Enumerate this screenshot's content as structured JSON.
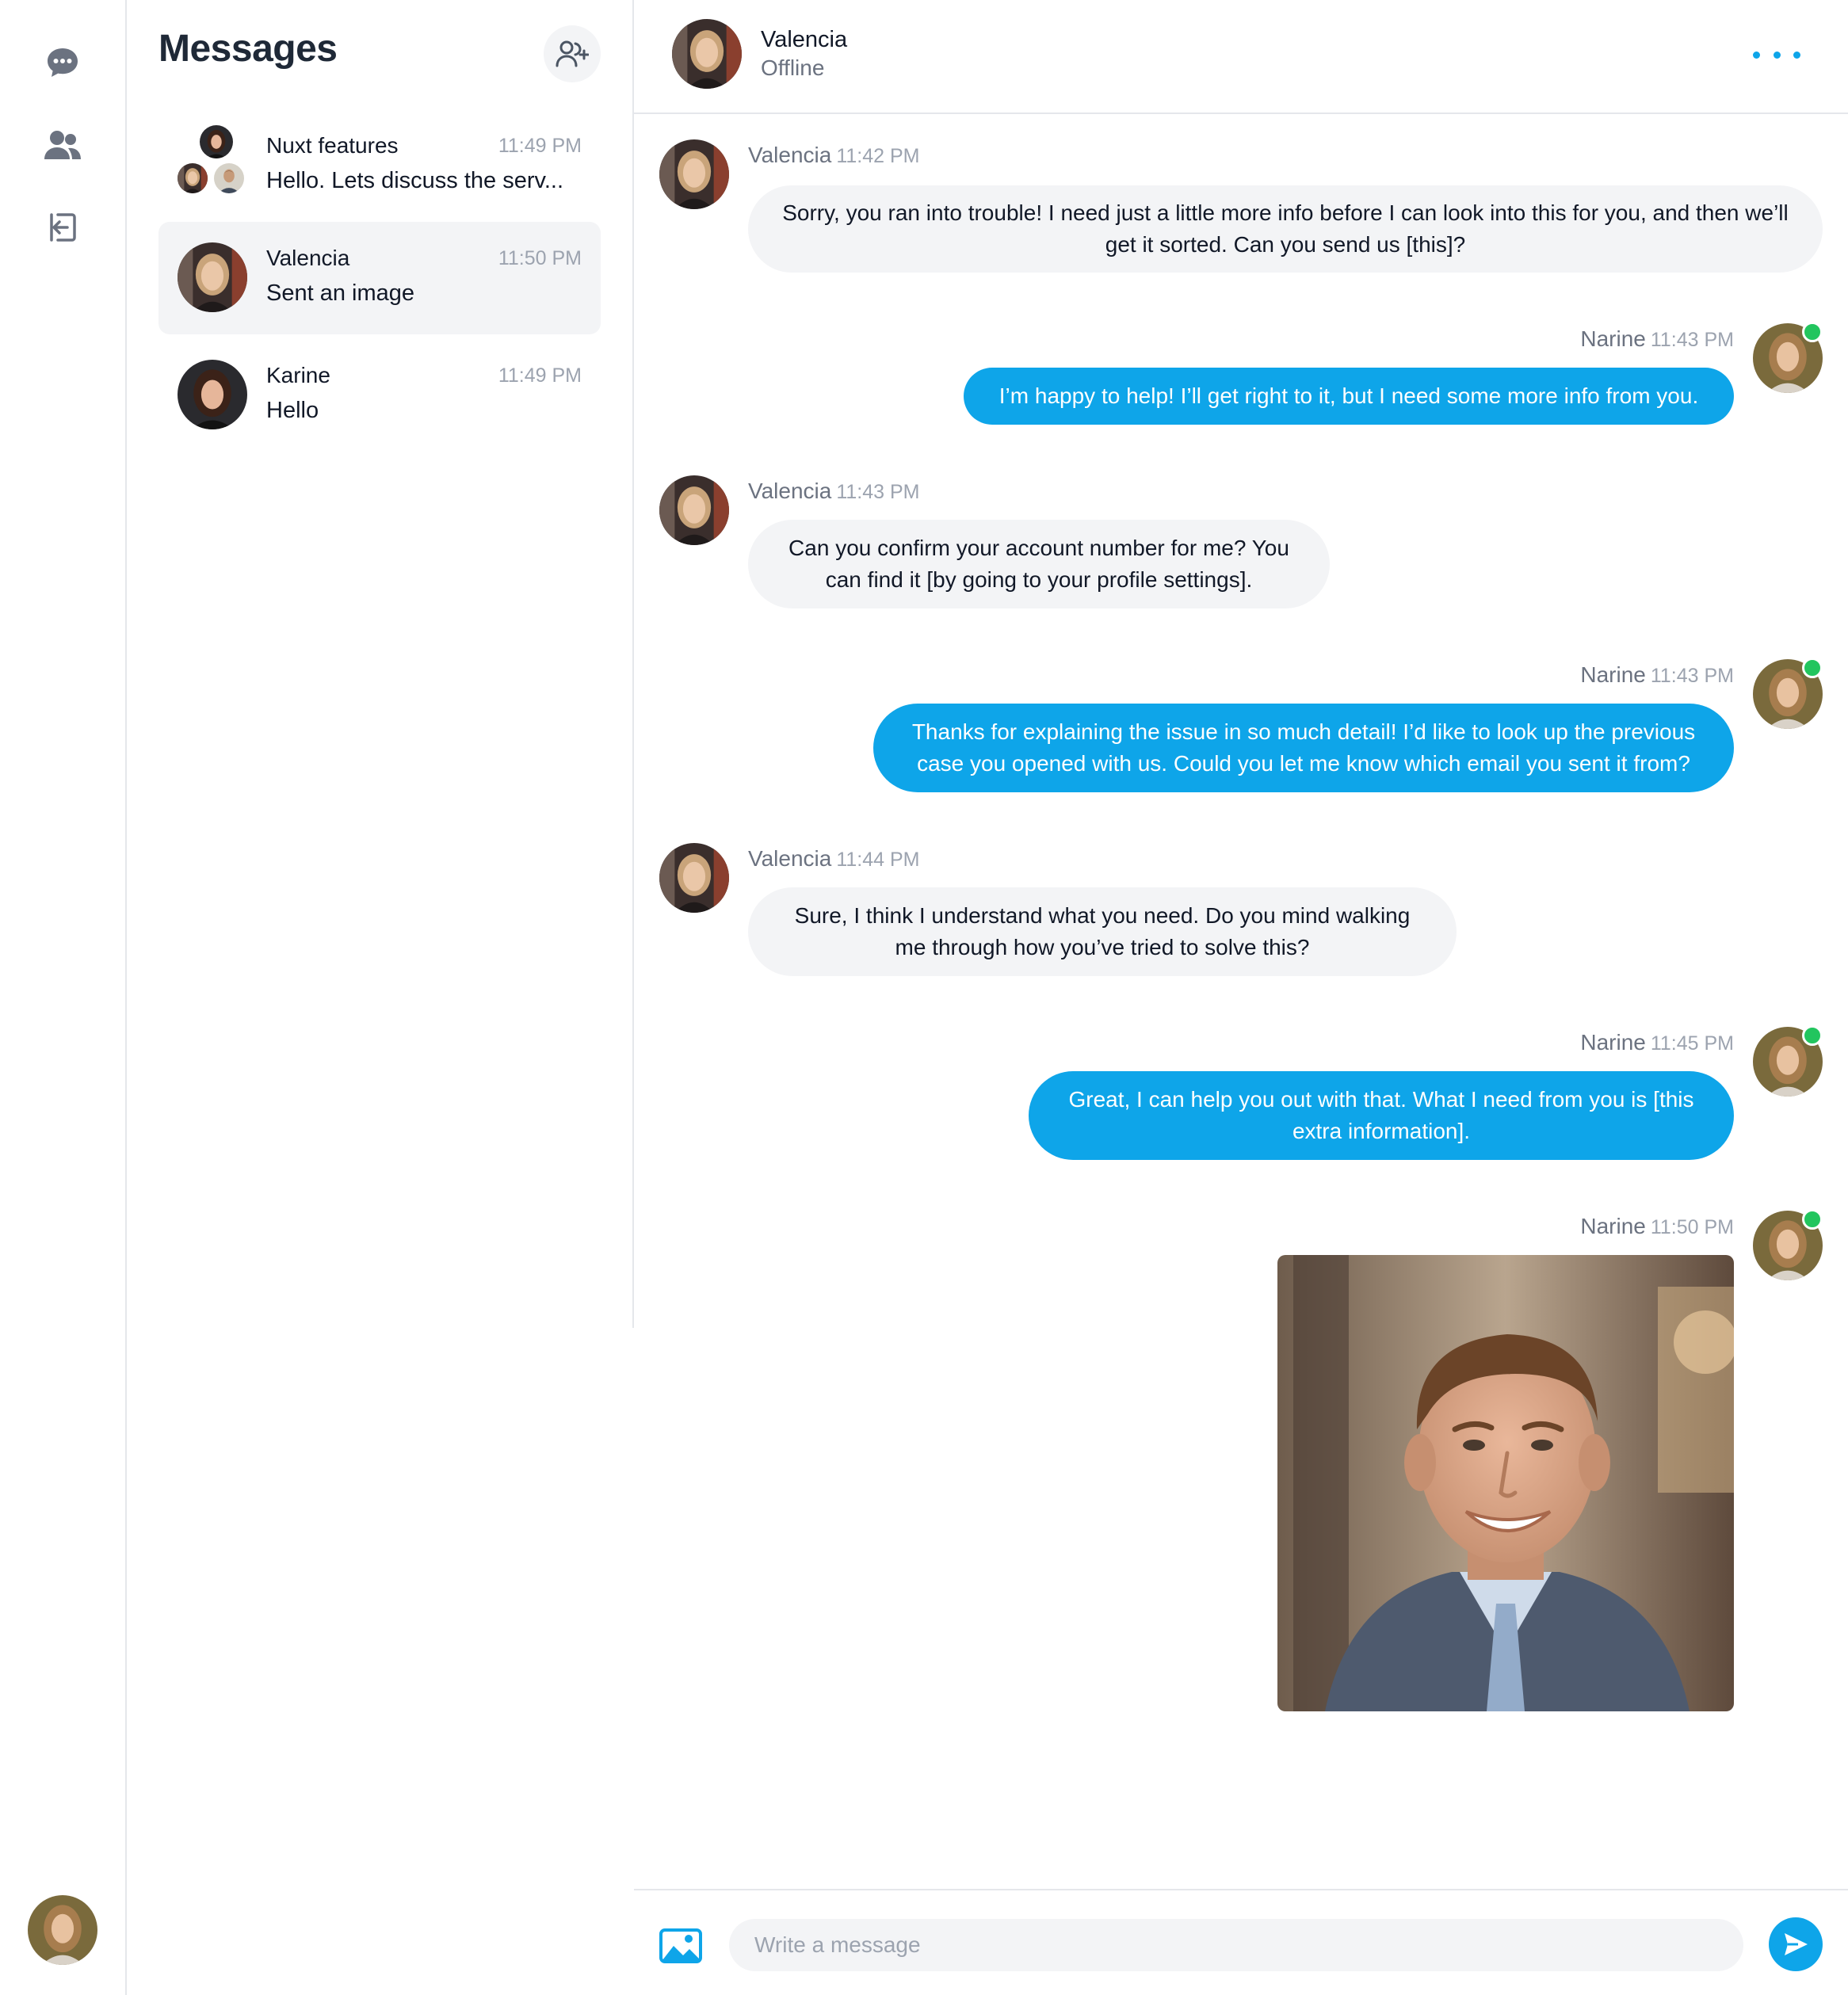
{
  "sidebar": {
    "icons": [
      "chat-icon",
      "users-icon",
      "logout-icon"
    ]
  },
  "list": {
    "title": "Messages",
    "conversations": [
      {
        "name": "Nuxt features",
        "time": "11:49 PM",
        "preview": "Hello. Lets discuss the serv..."
      },
      {
        "name": "Valencia",
        "time": "11:50 PM",
        "preview": "Sent an image"
      },
      {
        "name": "Karine",
        "time": "11:49 PM",
        "preview": "Hello"
      }
    ]
  },
  "chat": {
    "contact_name": "Valencia",
    "contact_status": "Offline",
    "messages": [
      {
        "sender": "Valencia",
        "time": "11:42 PM",
        "text": "Sorry, you ran into trouble! I need just a little more info before I can look into this for you, and then we’ll get it sorted. Can you send us [this]?"
      },
      {
        "sender": "Narine",
        "time": "11:43 PM",
        "text": "I’m happy to help! I’ll get right to it, but I need some more info from you."
      },
      {
        "sender": "Valencia",
        "time": "11:43 PM",
        "text": "Can you confirm your account number for me? You can find it [by going to your profile settings]."
      },
      {
        "sender": "Narine",
        "time": "11:43 PM",
        "text": "Thanks for explaining the issue in so much detail! I’d like to look up the previous case you opened with us. Could you let me know which email you sent it from?"
      },
      {
        "sender": "Valencia",
        "time": "11:44 PM",
        "text": "Sure, I think I understand what you need. Do you mind walking me through how you’ve tried to solve this?"
      },
      {
        "sender": "Narine",
        "time": "11:45 PM",
        "text": "Great, I can help you out with that. What I need from you is [this extra information]."
      },
      {
        "sender": "Narine",
        "time": "11:50 PM",
        "text": ""
      }
    ]
  },
  "composer": {
    "placeholder": "Write a message"
  },
  "colors": {
    "accent": "#0ea5e9",
    "online": "#22c55e",
    "bubble_in": "#f3f4f6"
  }
}
